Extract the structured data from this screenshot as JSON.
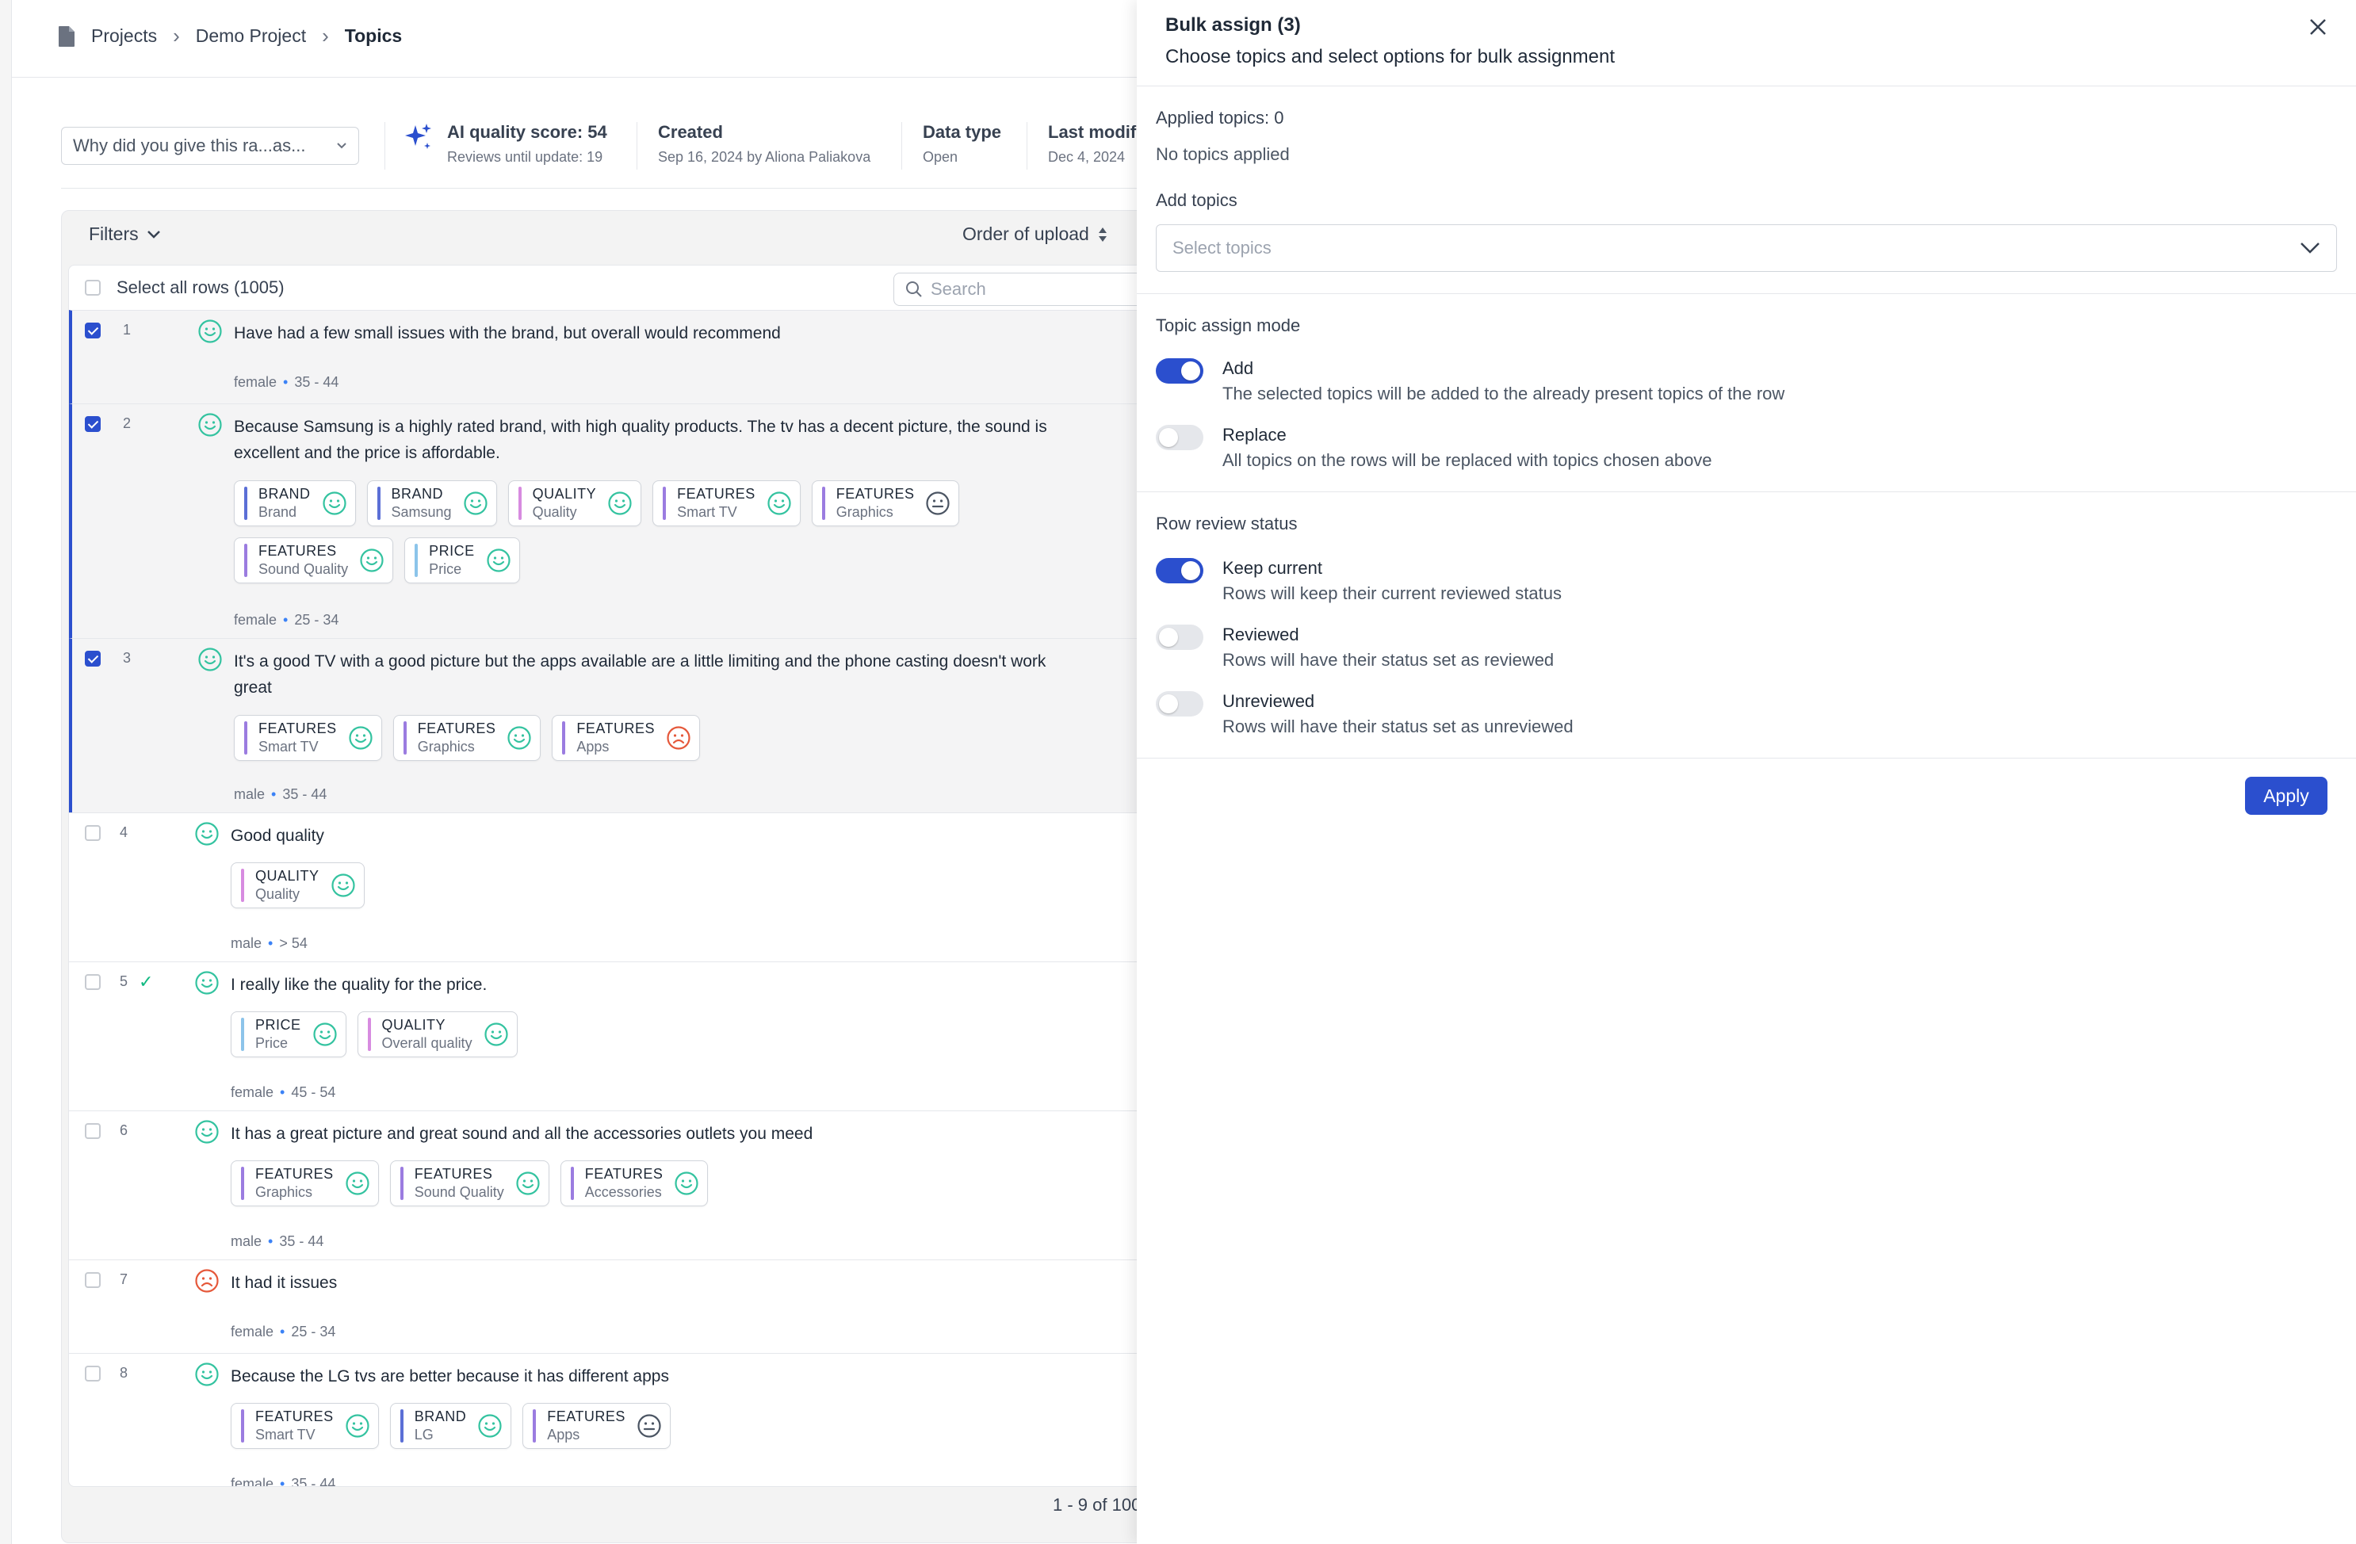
{
  "breadcrumb": {
    "items": [
      "Projects",
      "Demo Project"
    ],
    "current": "Topics"
  },
  "question_select": {
    "value": "Why did you give this ra...as..."
  },
  "meta": {
    "ai_score": {
      "title": "AI quality score: 54",
      "sub": "Reviews until update: 19"
    },
    "created": {
      "title": "Created",
      "sub": "Sep 16, 2024 by Aliona Paliakova"
    },
    "data_type": {
      "title": "Data type",
      "sub": "Open"
    },
    "last_modified": {
      "title": "Last modifie",
      "sub": "Dec 4, 2024"
    }
  },
  "toolbar": {
    "filters": "Filters",
    "order": "Order of upload"
  },
  "table": {
    "select_all": "Select all rows (1005)",
    "search_placeholder": "Search",
    "pagination": "1 - 9 of 100"
  },
  "rows": [
    {
      "num": "1",
      "text": "Have had a few small issues with the brand, but overall would recommend",
      "gender": "female",
      "age": "35 - 44"
    },
    {
      "num": "2",
      "text": "Because Samsung is a highly rated brand, with high quality products. The tv has a decent picture, the sound is excellent and the price is affordable.",
      "gender": "female",
      "age": "25 - 34",
      "chips": [
        {
          "cat": "BRAND",
          "sub": "Brand"
        },
        {
          "cat": "BRAND",
          "sub": "Samsung"
        },
        {
          "cat": "QUALITY",
          "sub": "Quality"
        },
        {
          "cat": "FEATURES",
          "sub": "Smart TV"
        },
        {
          "cat": "FEATURES",
          "sub": "Graphics"
        },
        {
          "cat": "FEATURES",
          "sub": "Sound Quality"
        },
        {
          "cat": "PRICE",
          "sub": "Price"
        }
      ]
    },
    {
      "num": "3",
      "text": "It's a good TV with a good picture but the apps available are a little limiting and the phone casting doesn't work great",
      "gender": "male",
      "age": "35 - 44",
      "chips": [
        {
          "cat": "FEATURES",
          "sub": "Smart TV"
        },
        {
          "cat": "FEATURES",
          "sub": "Graphics"
        },
        {
          "cat": "FEATURES",
          "sub": "Apps"
        }
      ]
    },
    {
      "num": "4",
      "text": "Good quality",
      "gender": "male",
      "age": "> 54",
      "chips": [
        {
          "cat": "QUALITY",
          "sub": "Quality"
        }
      ]
    },
    {
      "num": "5",
      "text": "I really like the quality for the price.",
      "gender": "female",
      "age": "45 - 54",
      "chips": [
        {
          "cat": "PRICE",
          "sub": "Price"
        },
        {
          "cat": "QUALITY",
          "sub": "Overall quality"
        }
      ]
    },
    {
      "num": "6",
      "text": "It has a great picture and great sound and all the accessories outlets you meed",
      "gender": "male",
      "age": "35 - 44",
      "chips": [
        {
          "cat": "FEATURES",
          "sub": "Graphics"
        },
        {
          "cat": "FEATURES",
          "sub": "Sound Quality"
        },
        {
          "cat": "FEATURES",
          "sub": "Accessories"
        }
      ]
    },
    {
      "num": "7",
      "text": "It had it issues",
      "gender": "female",
      "age": "25 - 34"
    },
    {
      "num": "8",
      "text": "Because the LG tvs are better because it has different apps",
      "gender": "female",
      "age": "35 - 44",
      "chips": [
        {
          "cat": "FEATURES",
          "sub": "Smart TV"
        },
        {
          "cat": "BRAND",
          "sub": "LG"
        },
        {
          "cat": "FEATURES",
          "sub": "Apps"
        }
      ]
    }
  ],
  "panel": {
    "title": "Bulk assign (3)",
    "subtitle": "Choose topics and select options for bulk assignment",
    "applied_label": "Applied topics: 0",
    "no_topics": "No topics applied",
    "add_topics_label": "Add topics",
    "select_placeholder": "Select topics",
    "assign_mode_label": "Topic assign mode",
    "mode_add": {
      "title": "Add",
      "desc": "The selected topics will be added to the already present topics of the row"
    },
    "mode_replace": {
      "title": "Replace",
      "desc": "All topics on the rows will be replaced with topics chosen above"
    },
    "review_label": "Row review status",
    "status_keep": {
      "title": "Keep current",
      "desc": "Rows will keep their current reviewed status"
    },
    "status_reviewed": {
      "title": "Reviewed",
      "desc": "Rows will have their status set as reviewed"
    },
    "status_unreviewed": {
      "title": "Unreviewed",
      "desc": "Rows will have their status set as unreviewed"
    },
    "apply": "Apply"
  },
  "colors": {
    "accent": "#2b4fce",
    "positive": "#34c3a0",
    "negative": "#e5583a",
    "neutral": "#4b5563",
    "brand_bar": "#5b6fd6",
    "quality_bar": "#d78be0",
    "features_bar": "#9b7ce0",
    "price_bar": "#8cc4ea"
  }
}
